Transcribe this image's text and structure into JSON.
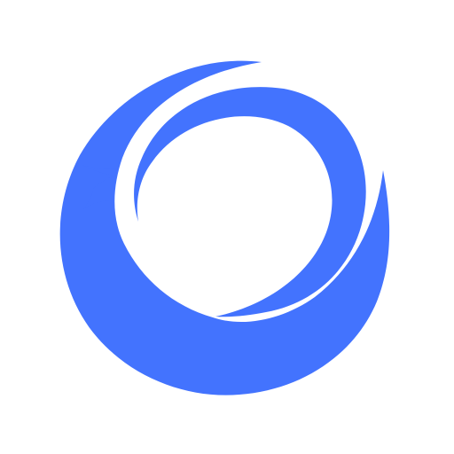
{
  "logo": {
    "icon": "crescent-ring-sparkle-icon",
    "colors": {
      "primary": "#4373FE",
      "background": "#FFFFFF"
    }
  }
}
